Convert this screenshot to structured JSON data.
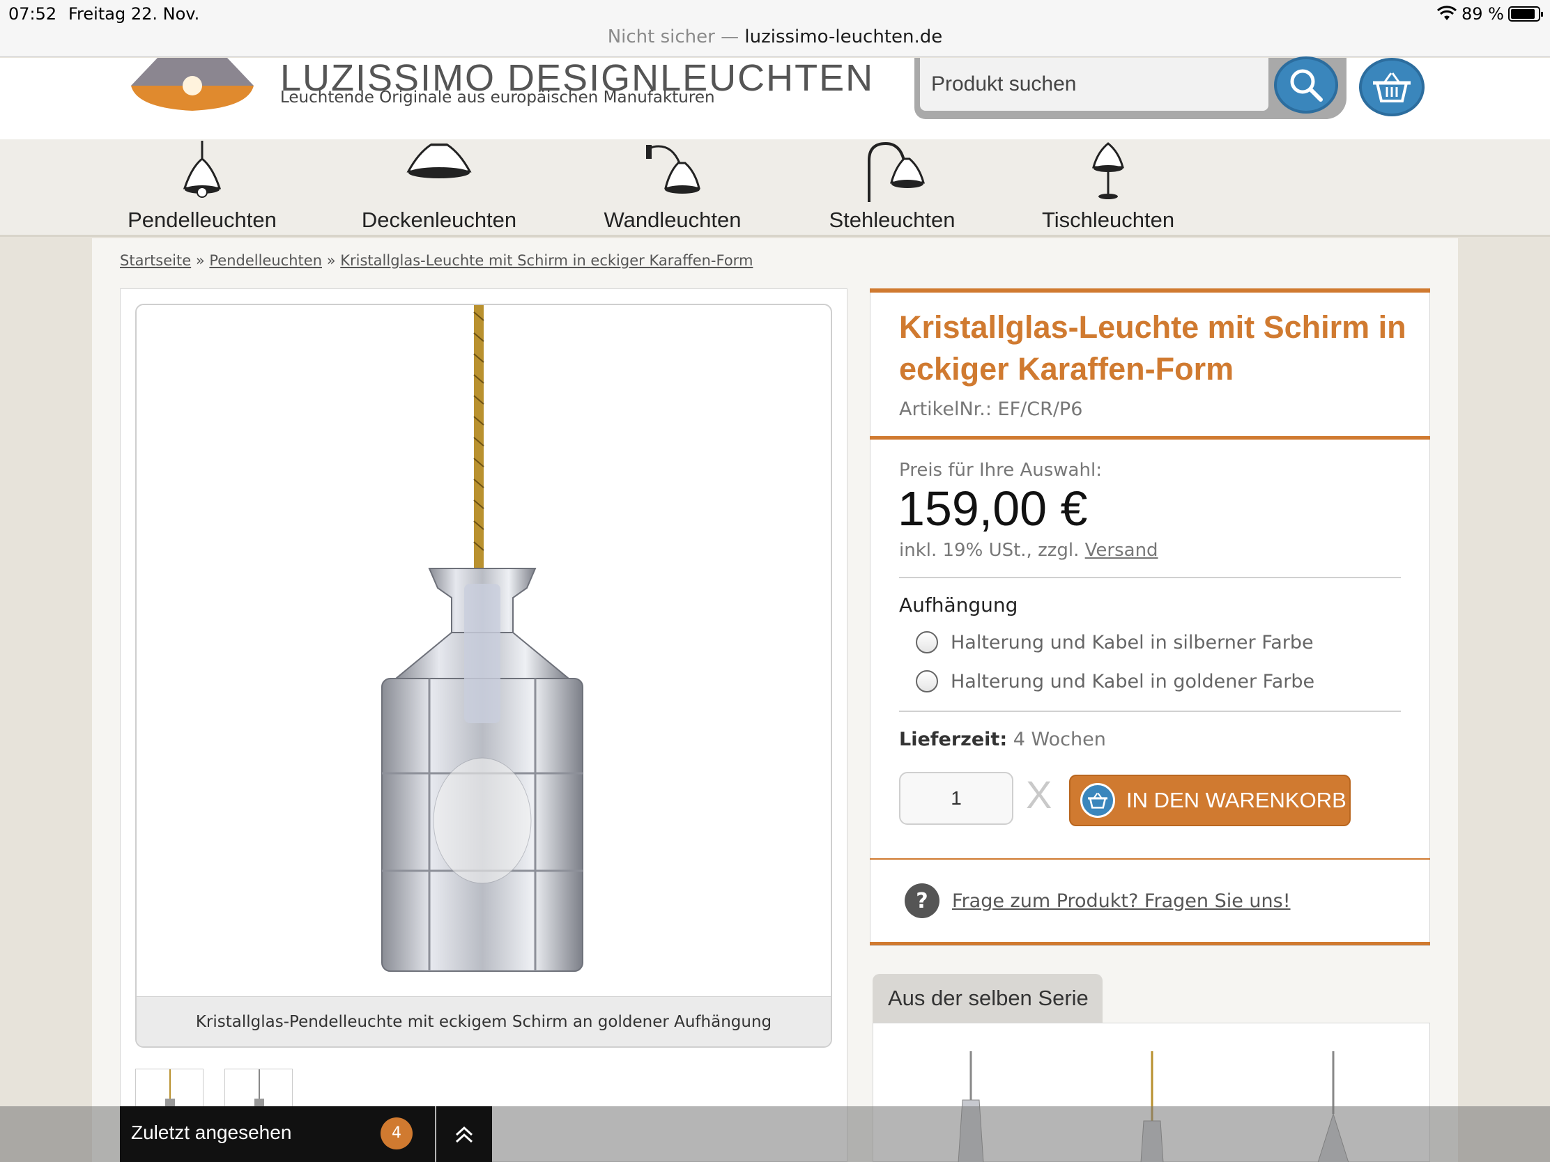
{
  "status_bar": {
    "time": "07:52",
    "date": "Freitag 22. Nov.",
    "battery": "89 %",
    "battery_level": 0.89
  },
  "url_bar": {
    "security": "Nicht sicher —",
    "host": "luzissimo-leuchten.de"
  },
  "header": {
    "brand": "LUZISSIMO DESIGNLEUCHTEN",
    "tagline": "Leuchtende Originale aus europäischen Manufakturen",
    "search_placeholder": "Produkt suchen",
    "accent_color": "#3a86bc"
  },
  "categories": [
    {
      "label": "Pendelleuchten",
      "icon": "pendant-lamp-icon"
    },
    {
      "label": "Deckenleuchten",
      "icon": "ceiling-lamp-icon"
    },
    {
      "label": "Wandleuchten",
      "icon": "wall-lamp-icon"
    },
    {
      "label": "Stehleuchten",
      "icon": "floor-lamp-icon"
    },
    {
      "label": "Tischleuchten",
      "icon": "table-lamp-icon"
    }
  ],
  "breadcrumb": {
    "home": "Startseite",
    "sep": "»",
    "category": "Pendelleuchten",
    "current": "Kristallglas-Leuchte mit Schirm in eckiger Karaffen-Form"
  },
  "gallery": {
    "caption": "Kristallglas-Pendelleuchte mit eckigem Schirm an goldener Aufhängung"
  },
  "product": {
    "title": "Kristallglas-Leuchte mit Schirm in eckiger Karaffen-Form",
    "article_no": "ArtikelNr.: EF/CR/P6",
    "price_label": "Preis für Ihre Auswahl:",
    "price": "159,00 €",
    "tax_text": "inkl. 19% USt., zzgl.",
    "shipping_link": "Versand",
    "option_title": "Aufhängung",
    "options": [
      "Halterung und Kabel in silberner Farbe",
      "Halterung und Kabel in goldener Farbe"
    ],
    "delivery_label": "Lieferzeit:",
    "delivery_value": "4 Wochen",
    "quantity": "1",
    "times": "X",
    "add_to_cart": "IN DEN WARENKORB",
    "question_link": "Frage zum Produkt? Fragen Sie uns!",
    "accent_color": "#d07a30"
  },
  "series": {
    "title": "Aus der selben Serie"
  },
  "recent": {
    "label": "Zuletzt angesehen",
    "count": "4"
  }
}
